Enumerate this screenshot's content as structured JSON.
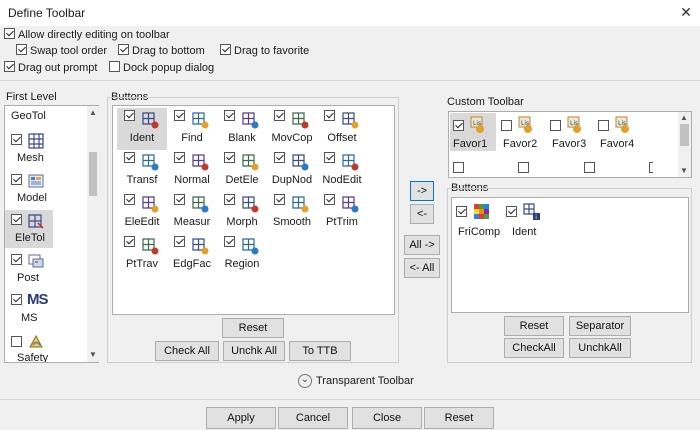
{
  "window": {
    "title": "Define Toolbar",
    "close_glyph": "✕"
  },
  "options": {
    "allow_direct_edit": {
      "label": "Allow directly editing on toolbar",
      "checked": true
    },
    "swap_tool_order": {
      "label": "Swap tool order",
      "checked": true
    },
    "drag_to_bottom": {
      "label": "Drag to bottom",
      "checked": true
    },
    "drag_to_favorite": {
      "label": "Drag to favorite",
      "checked": true
    },
    "drag_out_prompt": {
      "label": "Drag out prompt",
      "checked": true
    },
    "dock_popup_dialog": {
      "label": "Dock popup dialog",
      "checked": false
    }
  },
  "first_level": {
    "label": "First Level",
    "items": [
      {
        "label": "GeoTol",
        "checked": null,
        "icon": "geotol-icon"
      },
      {
        "label": "Mesh",
        "checked": true,
        "icon": "mesh-icon"
      },
      {
        "label": "Model",
        "checked": true,
        "icon": "model-icon"
      },
      {
        "label": "EleTol",
        "checked": true,
        "icon": "eletol-icon",
        "selected": true
      },
      {
        "label": "Post",
        "checked": true,
        "icon": "post-icon"
      },
      {
        "label": "MS",
        "checked": true,
        "icon": "ms-icon"
      },
      {
        "label": "Safety",
        "checked": false,
        "icon": "safety-icon"
      }
    ]
  },
  "buttons_group": {
    "label": "Buttons",
    "tools": [
      {
        "label": "Ident",
        "checked": true,
        "icon": "ident-icon",
        "selected": true
      },
      {
        "label": "Find",
        "checked": true,
        "icon": "find-icon"
      },
      {
        "label": "Blank",
        "checked": true,
        "icon": "blank-icon"
      },
      {
        "label": "MovCop",
        "checked": true,
        "icon": "movcop-icon"
      },
      {
        "label": "Offset",
        "checked": true,
        "icon": "offset-icon"
      },
      {
        "label": "Transf",
        "checked": true,
        "icon": "transf-icon"
      },
      {
        "label": "Normal",
        "checked": true,
        "icon": "normal-icon"
      },
      {
        "label": "DetEle",
        "checked": true,
        "icon": "detele-icon"
      },
      {
        "label": "DupNod",
        "checked": true,
        "icon": "dupnod-icon"
      },
      {
        "label": "NodEdit",
        "checked": true,
        "icon": "nodedit-icon"
      },
      {
        "label": "EleEdit",
        "checked": true,
        "icon": "eleedit-icon"
      },
      {
        "label": "Measur",
        "checked": true,
        "icon": "measur-icon"
      },
      {
        "label": "Morph",
        "checked": true,
        "icon": "morph-icon"
      },
      {
        "label": "Smooth",
        "checked": true,
        "icon": "smooth-icon"
      },
      {
        "label": "PtTrim",
        "checked": true,
        "icon": "pttrim-icon"
      },
      {
        "label": "PtTrav",
        "checked": true,
        "icon": "pttrav-icon"
      },
      {
        "label": "EdgFac",
        "checked": true,
        "icon": "edgfac-icon"
      },
      {
        "label": "Region",
        "checked": true,
        "icon": "region-icon"
      }
    ],
    "reset": "Reset",
    "check_all": "Check All",
    "uncheck_all": "Unchk All",
    "to_ttb": "To TTB"
  },
  "transfer": {
    "add": "->",
    "remove": "<-",
    "add_all": "All ->",
    "remove_all": "<- All"
  },
  "custom_toolbar": {
    "label": "Custom Toolbar",
    "favorites": [
      {
        "label": "Favor1",
        "checked": true,
        "selected": true
      },
      {
        "label": "Favor2",
        "checked": false
      },
      {
        "label": "Favor3",
        "checked": false
      },
      {
        "label": "Favor4",
        "checked": false
      }
    ],
    "buttons_label": "Buttons",
    "buttons": [
      {
        "label": "FriComp",
        "checked": true,
        "icon": "fricomp-icon"
      },
      {
        "label": "Ident",
        "checked": true,
        "icon": "ident-icon"
      }
    ],
    "reset": "Reset",
    "separator": "Separator",
    "check_all": "CheckAll",
    "uncheck_all": "UnchkAll"
  },
  "transparent_toolbar": {
    "label": "Transparent Toolbar",
    "chevron": "⌄"
  },
  "footer": {
    "apply": "Apply",
    "cancel": "Cancel",
    "close": "Close",
    "reset": "Reset"
  },
  "colors": {
    "accent": "#0078d7",
    "selected_bg": "#d9d9d9",
    "button_bg": "#e1e1e1"
  }
}
